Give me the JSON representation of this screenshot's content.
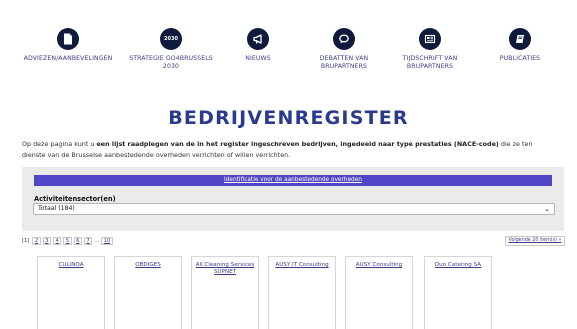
{
  "nav": [
    {
      "label": "ADVIEZEN/AANBEVELINGEN",
      "icon": "document-icon",
      "icon_text": ""
    },
    {
      "label": "STRATEGIE GO4BRUSSELS 2030",
      "icon": "strategy-2030-icon",
      "icon_text": "2030"
    },
    {
      "label": "NIEUWS",
      "icon": "megaphone-icon",
      "icon_text": ""
    },
    {
      "label": "DEBATTEN VAN BRUPARTNERS",
      "icon": "chat-bubbles-icon",
      "icon_text": ""
    },
    {
      "label": "TIJDSCHRIFT VAN BRUPARTNERS",
      "icon": "newspaper-icon",
      "icon_text": ""
    },
    {
      "label": "PUBLICATIES",
      "icon": "book-icon",
      "icon_text": ""
    }
  ],
  "page_title": "BEDRIJVENREGISTER",
  "intro": {
    "p1": "Op deze pagina kunt u ",
    "b1": "een lijst raadplegen van de in het register ingeschreven bedrijven, ingedeeld naar type prestaties (NACE-code)",
    "p2": " die ze ten dienste van de Brusselse aanbestedende overheden verrichten of willen verrichten."
  },
  "banner_link": "Identificatie voor de aanbestedende overheden",
  "sector": {
    "label": "Activiteitensector(en)",
    "selected": "Totaal (184)"
  },
  "pagination": {
    "current": "[1]",
    "pages": [
      "2",
      "3",
      "4",
      "5",
      "6",
      "7"
    ],
    "ellipsis": "...",
    "last": "10",
    "next": "Volgende 20 item(s) »"
  },
  "companies": [
    "CULINOA",
    "OBDIGES",
    "All Cleaning Services SUPNET",
    "AUSY IT Consulting",
    "AUSY Consulting",
    "Duo Catering SA"
  ],
  "colors": {
    "accent": "#5246c8",
    "title": "#2a3a8c",
    "link": "#3b3e8c",
    "icon_bg": "#0f1a3c"
  }
}
